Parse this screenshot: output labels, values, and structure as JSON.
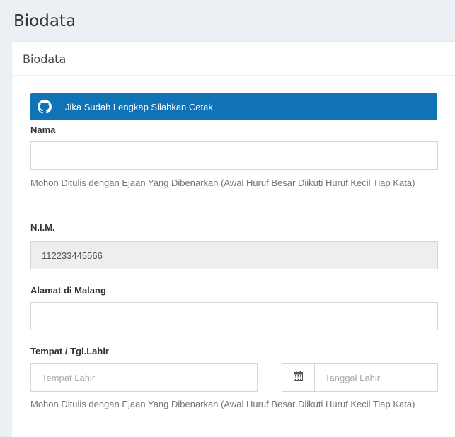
{
  "page": {
    "title": "Biodata"
  },
  "panel": {
    "title": "Biodata"
  },
  "alert": {
    "text": "Jika Sudah Lengkap Silahkan Cetak",
    "icon": "github-icon",
    "color": "#0f73b6"
  },
  "form": {
    "nama": {
      "label": "Nama",
      "value": ""
    },
    "nama_help": "Mohon Ditulis dengan Ejaan Yang Dibenarkan (Awal Huruf Besar Diikuti Huruf Kecil Tiap Kata)",
    "nim": {
      "label": "N.I.M.",
      "value": "112233445566"
    },
    "alamat": {
      "label": "Alamat di Malang",
      "value": ""
    },
    "ttl": {
      "label": "Tempat / Tgl.Lahir",
      "tempat_placeholder": "Tempat Lahir",
      "tanggal_placeholder": "Tanggal Lahir",
      "calendar_icon": "calendar-icon"
    },
    "ttl_help": "Mohon Ditulis dengan Ejaan Yang Dibenarkan (Awal Huruf Besar Diikuti Huruf Kecil Tiap Kata)"
  }
}
